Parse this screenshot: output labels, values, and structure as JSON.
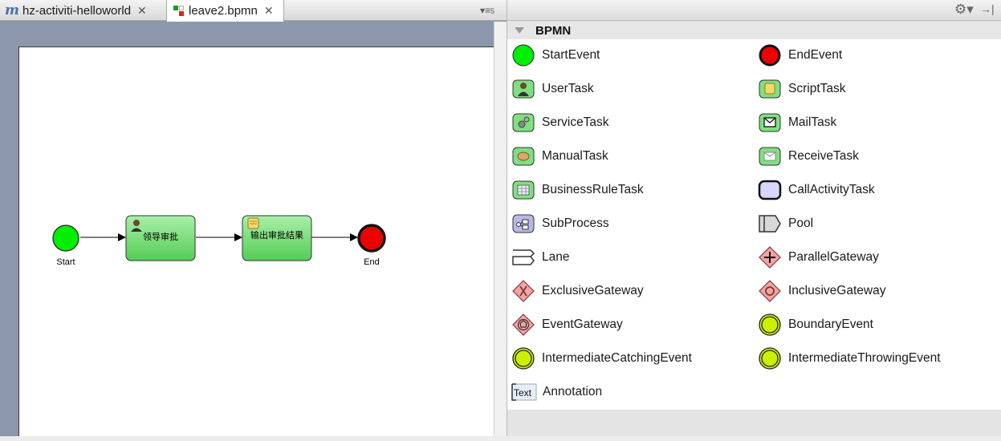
{
  "editor": {
    "tabs": [
      {
        "label": "hz-activiti-helloworld",
        "icon": "maven-m-icon",
        "active": false
      },
      {
        "label": "leave2.bpmn",
        "icon": "bpmn-file-icon",
        "active": true
      }
    ],
    "tab_overflow": "5",
    "diagram": {
      "start_label": "Start",
      "task1_label": "领导审批",
      "task2_label": "输出审批结果",
      "end_label": "End",
      "colors": {
        "start": "#00ee00",
        "task": "#66dd66",
        "end": "#ee0000"
      }
    }
  },
  "palette": {
    "drawer_title": "BPMN",
    "items": [
      {
        "label": "StartEvent",
        "icon": "start-event-icon"
      },
      {
        "label": "EndEvent",
        "icon": "end-event-icon"
      },
      {
        "label": "UserTask",
        "icon": "user-task-icon"
      },
      {
        "label": "ScriptTask",
        "icon": "script-task-icon"
      },
      {
        "label": "ServiceTask",
        "icon": "service-task-icon"
      },
      {
        "label": "MailTask",
        "icon": "mail-task-icon"
      },
      {
        "label": "ManualTask",
        "icon": "manual-task-icon"
      },
      {
        "label": "ReceiveTask",
        "icon": "receive-task-icon"
      },
      {
        "label": "BusinessRuleTask",
        "icon": "business-rule-task-icon"
      },
      {
        "label": "CallActivityTask",
        "icon": "call-activity-task-icon"
      },
      {
        "label": "SubProcess",
        "icon": "subprocess-icon"
      },
      {
        "label": "Pool",
        "icon": "pool-icon"
      },
      {
        "label": "Lane",
        "icon": "lane-icon"
      },
      {
        "label": "ParallelGateway",
        "icon": "parallel-gateway-icon"
      },
      {
        "label": "ExclusiveGateway",
        "icon": "exclusive-gateway-icon"
      },
      {
        "label": "InclusiveGateway",
        "icon": "inclusive-gateway-icon"
      },
      {
        "label": "EventGateway",
        "icon": "event-gateway-icon"
      },
      {
        "label": "BoundaryEvent",
        "icon": "boundary-event-icon"
      },
      {
        "label": "IntermediateCatchingEvent",
        "icon": "intermediate-catching-event-icon"
      },
      {
        "label": "IntermediateThrowingEvent",
        "icon": "intermediate-throwing-event-icon"
      },
      {
        "label": "Annotation",
        "icon": "annotation-icon",
        "icon_text": "Text"
      }
    ]
  }
}
